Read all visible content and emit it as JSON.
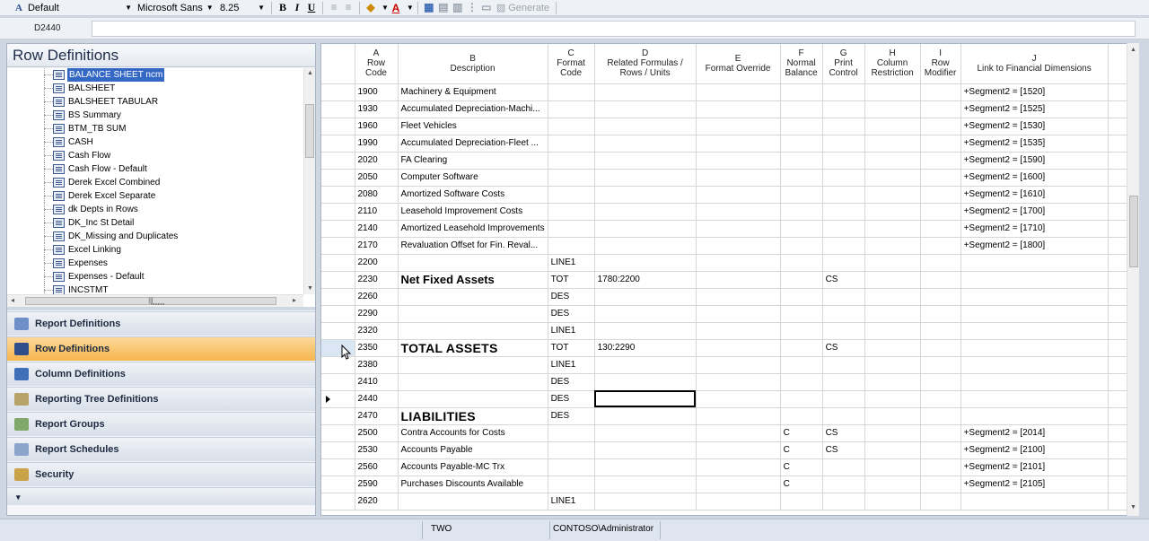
{
  "toolbar": {
    "style": "Default",
    "font": "Microsoft Sans",
    "size": "8.25",
    "bold": "B",
    "italic": "I",
    "underline": "U",
    "generate": "Generate"
  },
  "address": {
    "cell": "D2440"
  },
  "left_panel": {
    "title": "Row Definitions",
    "tree_items": [
      "BALANCE SHEET ncm",
      "BALSHEET",
      "BALSHEET TABULAR",
      "BS Summary",
      "BTM_TB SUM",
      "CASH",
      "Cash Flow",
      "Cash Flow - Default",
      "Derek Excel Combined",
      "Derek Excel Separate",
      "dk Depts in Rows",
      "DK_Inc St Detail",
      "DK_Missing and Duplicates",
      "Excel Linking",
      "Expenses",
      "Expenses - Default",
      "INCSTMT"
    ],
    "nav_buttons": [
      "Report Definitions",
      "Row Definitions",
      "Column Definitions",
      "Reporting Tree Definitions",
      "Report Groups",
      "Report Schedules",
      "Security"
    ]
  },
  "grid": {
    "columns": [
      {
        "letter": "A",
        "title": "Row\nCode"
      },
      {
        "letter": "B",
        "title": "Description"
      },
      {
        "letter": "C",
        "title": "Format\nCode"
      },
      {
        "letter": "D",
        "title": "Related Formulas /\nRows / Units"
      },
      {
        "letter": "E",
        "title": "Format Override"
      },
      {
        "letter": "F",
        "title": "Normal\nBalance"
      },
      {
        "letter": "G",
        "title": "Print\nControl"
      },
      {
        "letter": "H",
        "title": "Column\nRestriction"
      },
      {
        "letter": "I",
        "title": "Row\nModifier"
      },
      {
        "letter": "J",
        "title": "Link to Financial Dimensions"
      }
    ],
    "rows": [
      [
        "1900",
        "Machinery & Equipment",
        "",
        "",
        "",
        "",
        "",
        "",
        "",
        "+Segment2 = [1520]"
      ],
      [
        "1930",
        "Accumulated Depreciation-Machi...",
        "",
        "",
        "",
        "",
        "",
        "",
        "",
        "+Segment2 = [1525]"
      ],
      [
        "1960",
        "Fleet Vehicles",
        "",
        "",
        "",
        "",
        "",
        "",
        "",
        "+Segment2 = [1530]"
      ],
      [
        "1990",
        "Accumulated Depreciation-Fleet ...",
        "",
        "",
        "",
        "",
        "",
        "",
        "",
        "+Segment2 = [1535]"
      ],
      [
        "2020",
        "FA Clearing",
        "",
        "",
        "",
        "",
        "",
        "",
        "",
        "+Segment2 = [1590]"
      ],
      [
        "2050",
        "Computer Software",
        "",
        "",
        "",
        "",
        "",
        "",
        "",
        "+Segment2 = [1600]"
      ],
      [
        "2080",
        "Amortized Software Costs",
        "",
        "",
        "",
        "",
        "",
        "",
        "",
        "+Segment2 = [1610]"
      ],
      [
        "2110",
        "Leasehold Improvement Costs",
        "",
        "",
        "",
        "",
        "",
        "",
        "",
        "+Segment2 = [1700]"
      ],
      [
        "2140",
        "Amortized Leasehold Improvements",
        "",
        "",
        "",
        "",
        "",
        "",
        "",
        "+Segment2 = [1710]"
      ],
      [
        "2170",
        "Revaluation Offset for Fin. Reval...",
        "",
        "",
        "",
        "",
        "",
        "",
        "",
        "+Segment2 = [1800]"
      ],
      [
        "2200",
        "",
        "LINE1",
        "",
        "",
        "",
        "",
        "",
        "",
        ""
      ],
      [
        "2230",
        "Net Fixed Assets",
        "TOT",
        "1780:2200",
        "",
        "",
        "CS",
        "",
        "",
        ""
      ],
      [
        "2260",
        "",
        "DES",
        "",
        "",
        "",
        "",
        "",
        "",
        ""
      ],
      [
        "2290",
        "",
        "DES",
        "",
        "",
        "",
        "",
        "",
        "",
        ""
      ],
      [
        "2320",
        "",
        "LINE1",
        "",
        "",
        "",
        "",
        "",
        "",
        ""
      ],
      [
        "2350",
        "TOTAL ASSETS",
        "TOT",
        "130:2290",
        "",
        "",
        "CS",
        "",
        "",
        ""
      ],
      [
        "2380",
        "",
        "LINE1",
        "",
        "",
        "",
        "",
        "",
        "",
        ""
      ],
      [
        "2410",
        "",
        "DES",
        "",
        "",
        "",
        "",
        "",
        "",
        ""
      ],
      [
        "2440",
        "",
        "DES",
        "",
        "",
        "",
        "",
        "",
        "",
        ""
      ],
      [
        "2470",
        "LIABILITIES",
        "DES",
        "",
        "",
        "",
        "",
        "",
        "",
        ""
      ],
      [
        "2500",
        "Contra Accounts for Costs",
        "",
        "",
        "",
        "C",
        "CS",
        "",
        "",
        "+Segment2 = [2014]"
      ],
      [
        "2530",
        "Accounts Payable",
        "",
        "",
        "",
        "C",
        "CS",
        "",
        "",
        "+Segment2 = [2100]"
      ],
      [
        "2560",
        "Accounts Payable-MC Trx",
        "",
        "",
        "",
        "C",
        "",
        "",
        "",
        "+Segment2 = [2101]"
      ],
      [
        "2590",
        "Purchases Discounts Available",
        "",
        "",
        "",
        "C",
        "",
        "",
        "",
        "+Segment2 = [2105]"
      ],
      [
        "2620",
        "",
        "LINE1",
        "",
        "",
        "",
        "",
        "",
        "",
        ""
      ]
    ]
  },
  "status": {
    "company": "TWO",
    "user": "CONTOSO\\Administrator"
  }
}
